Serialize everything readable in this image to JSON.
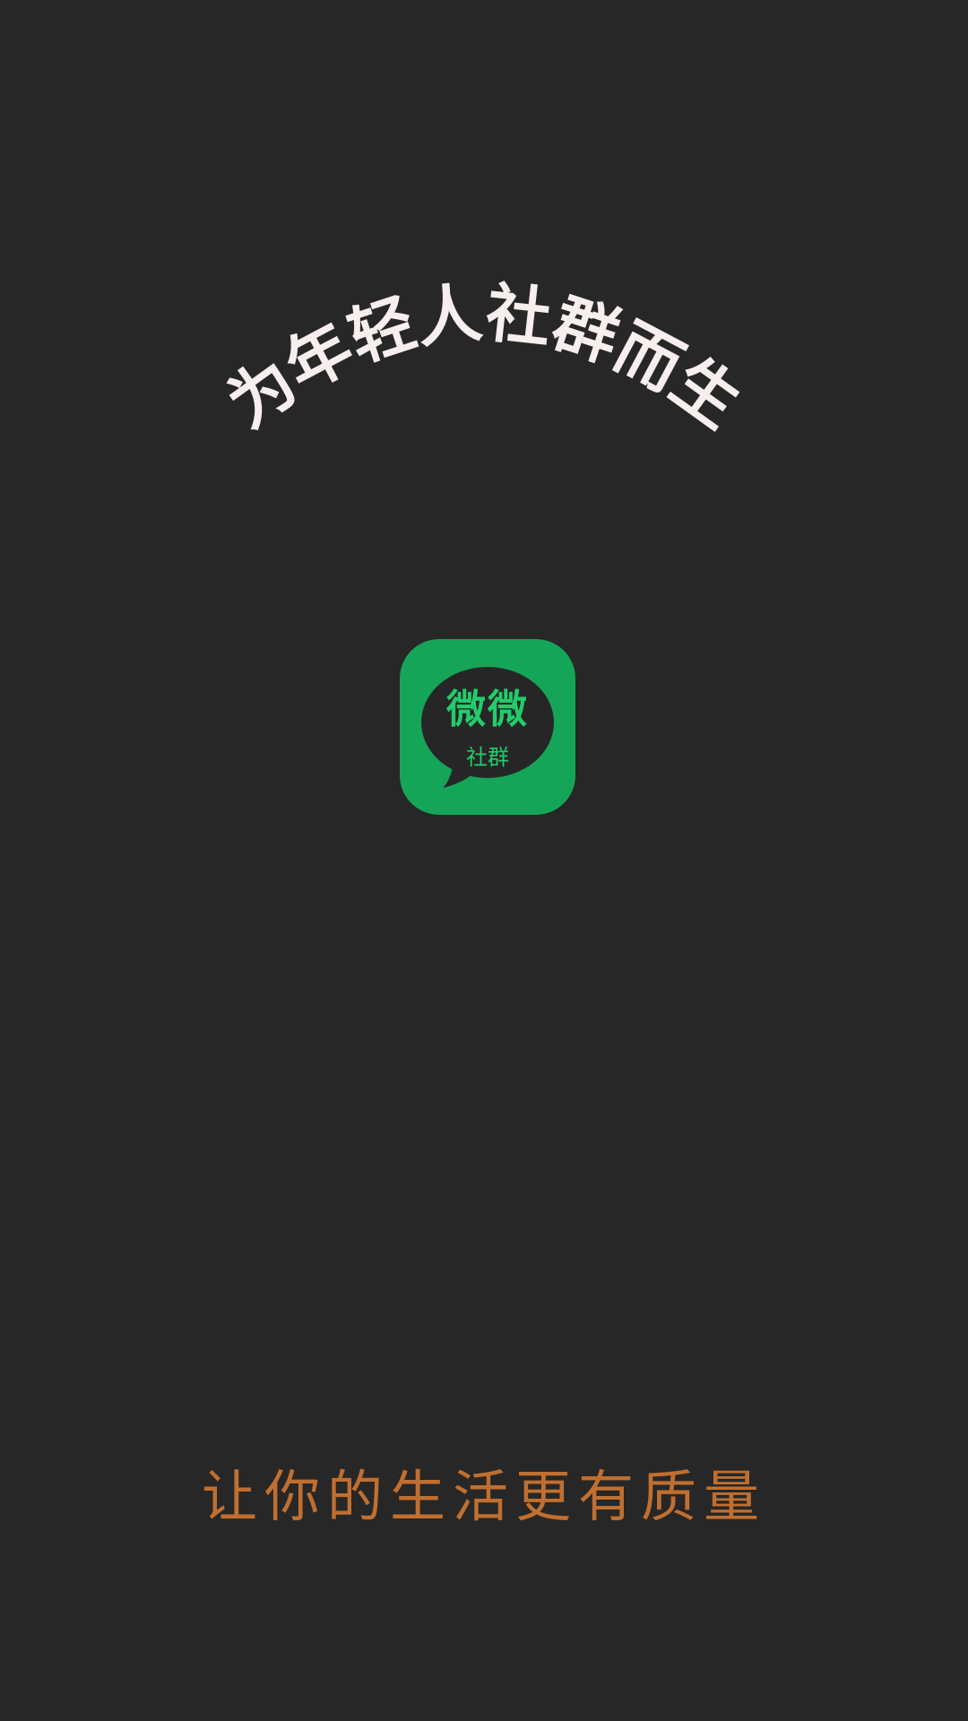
{
  "splash": {
    "tagline": "为年轻人社群而生",
    "logo": {
      "title": "微微",
      "subtitle": "社群"
    },
    "slogan": "让你的生活更有质量"
  },
  "colors": {
    "background": "#272727",
    "tagline": "#f7eeee",
    "logo_bg": "#15a558",
    "logo_bubble": "#262626",
    "logo_text": "#22cc6a",
    "slogan": "#c06f30"
  }
}
